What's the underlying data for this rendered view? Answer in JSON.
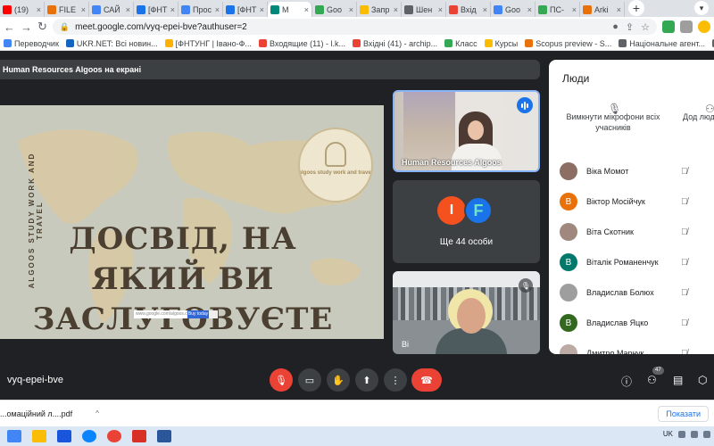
{
  "browser": {
    "tabs": [
      {
        "label": "(19)",
        "color": "#ff0000"
      },
      {
        "label": "FILE",
        "color": "#e8710a"
      },
      {
        "label": "САЙ",
        "color": "#4285f4"
      },
      {
        "label": "[ФНТ",
        "color": "#1a73e8"
      },
      {
        "label": "Прос",
        "color": "#4285f4"
      },
      {
        "label": "[ФНТ",
        "color": "#1a73e8"
      },
      {
        "label": "M",
        "color": "#00897b",
        "active": true
      },
      {
        "label": "Goo",
        "color": "#34a853"
      },
      {
        "label": "Запр",
        "color": "#fbbc04"
      },
      {
        "label": "Шен",
        "color": "#5f6368"
      },
      {
        "label": "Вхід",
        "color": "#ea4335"
      },
      {
        "label": "Goo",
        "color": "#4285f4"
      },
      {
        "label": "ПС-",
        "color": "#34a853"
      },
      {
        "label": "Arki",
        "color": "#e8710a"
      }
    ],
    "url": "meet.google.com/vyq-epei-bve?authuser=2",
    "bookmarks": [
      {
        "label": "Переводчик",
        "color": "#4285f4"
      },
      {
        "label": "UKR.NET: Всі новин...",
        "color": "#1565c0"
      },
      {
        "label": "[ФНТУНГ | Івано-Ф...",
        "color": "#ffb300"
      },
      {
        "label": "Входящие (11) - l.k...",
        "color": "#ea4335"
      },
      {
        "label": "Вхідні (41) - archip...",
        "color": "#ea4335"
      },
      {
        "label": "Класс",
        "color": "#34a853"
      },
      {
        "label": "Курсы",
        "color": "#fbbc04"
      },
      {
        "label": "Scopus preview - S...",
        "color": "#e8710a"
      },
      {
        "label": "Національне агент...",
        "color": "#5f6368"
      },
      {
        "label": "l.konsevich@nung.e...",
        "color": "#5f6368"
      }
    ]
  },
  "meet": {
    "presenter_banner": "Human Resources Algoos на екрані",
    "slide": {
      "side_text": "ALGOOS STUDY WORK AND TRAVEL",
      "logo_text": "algoos study work and travel",
      "headline": "ДОСВІД, НА ЯКИЙ ВИ ЗАСЛУГОВУЄТЕ",
      "mini_field": "www.google.com/algoos.com",
      "mini_button": "Buy today"
    },
    "tiles": {
      "speaker_name": "Human Resources Algoos",
      "more_avatars": [
        "І",
        "F"
      ],
      "more_label": "Ще 44 особи",
      "third_name": "Ві"
    },
    "people_panel": {
      "title": "Люди",
      "mute_all": "Вимкнути мікрофони всіх учасників",
      "second_action": "Дод люд",
      "participants": [
        {
          "name": "Віка Момот",
          "initial": "",
          "color": "#8d6e63"
        },
        {
          "name": "Віктор Мосійчук",
          "initial": "В",
          "color": "#e8710a"
        },
        {
          "name": "Віта Скотник",
          "initial": "",
          "color": "#a1887f"
        },
        {
          "name": "Віталік Романенчук",
          "initial": "В",
          "color": "#00796b"
        },
        {
          "name": "Владислав Болюх",
          "initial": "",
          "color": "#9e9e9e"
        },
        {
          "name": "Владислав Яцко",
          "initial": "В",
          "color": "#33691e"
        },
        {
          "name": "Дмитро Марчук",
          "initial": "",
          "color": "#bcaaa4"
        }
      ]
    },
    "meeting_code": "vyq-epei-bve",
    "participant_count": "47"
  },
  "downloads": {
    "file": "...омаційний л....pdf",
    "show_all": "Показати"
  },
  "taskbar": {
    "lang": "UK"
  },
  "colors": {
    "accent": "#1a73e8",
    "end_call": "#ea4335",
    "meet_bg": "#202124"
  }
}
